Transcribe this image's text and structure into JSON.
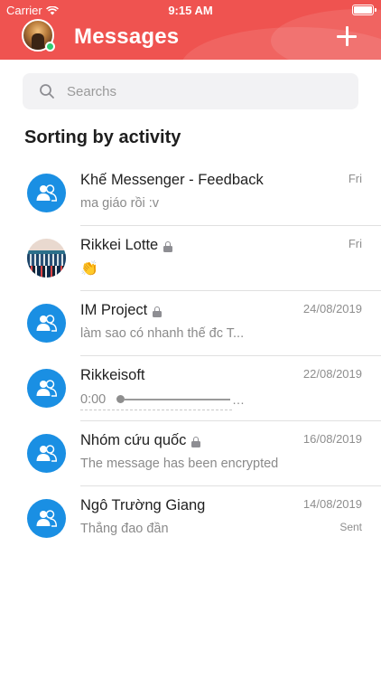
{
  "status_bar": {
    "carrier": "Carrier",
    "time": "9:15 AM"
  },
  "header": {
    "title": "Messages",
    "accent_color": "#ef5350",
    "add_icon": "plus-icon"
  },
  "search": {
    "placeholder": "Searchs",
    "value": ""
  },
  "section_title": "Sorting by activity",
  "conversations": [
    {
      "name": "Khế Messenger - Feedback",
      "preview": "ma giáo rồi :v",
      "date": "Fri",
      "avatar": "group-icon",
      "locked": false
    },
    {
      "name": "Rikkei Lotte",
      "preview": "👏",
      "date": "Fri",
      "avatar": "photo",
      "locked": true
    },
    {
      "name": "IM Project",
      "preview": "làm sao có nhanh thế đc T...",
      "date": "24/08/2019",
      "avatar": "group-icon",
      "locked": true
    },
    {
      "name": "Rikkeisoft",
      "preview": "0:00",
      "date": "22/08/2019",
      "avatar": "group-icon",
      "locked": false,
      "voice_progress": 0.0
    },
    {
      "name": "Nhóm cứu quốc",
      "preview": "The message has been encrypted",
      "date": "16/08/2019",
      "avatar": "group-icon",
      "locked": true
    },
    {
      "name": "Ngô Trường Giang",
      "preview": "Thẳng đao đần",
      "date": "14/08/2019",
      "avatar": "group-icon",
      "locked": false,
      "status": "Sent"
    }
  ]
}
